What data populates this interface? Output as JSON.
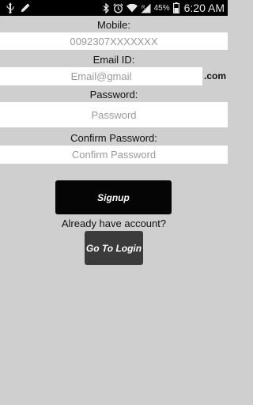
{
  "status_bar": {
    "battery_percent": "45%",
    "time": "6:20 AM",
    "icons": [
      "usb-icon",
      "pencil-icon",
      "bluetooth-icon",
      "alarm-icon",
      "wifi-icon",
      "signal-icon",
      "battery-icon"
    ]
  },
  "form": {
    "mobile_label": "Mobile:",
    "mobile_placeholder": "0092307XXXXXXX",
    "email_label": "Email ID:",
    "email_placeholder": "Email@gmail",
    "email_suffix": ".com",
    "password_label": "Password:",
    "password_placeholder": "Password",
    "confirm_label": "Confirm Password:",
    "confirm_placeholder": "Confirm Password"
  },
  "actions": {
    "signup_label": "Signup",
    "already_text": "Already have account?",
    "login_label": "Go To Login"
  },
  "colors": {
    "background": "#cfcfcf",
    "signup_button": "#050505",
    "login_button": "#3b3b3b"
  }
}
